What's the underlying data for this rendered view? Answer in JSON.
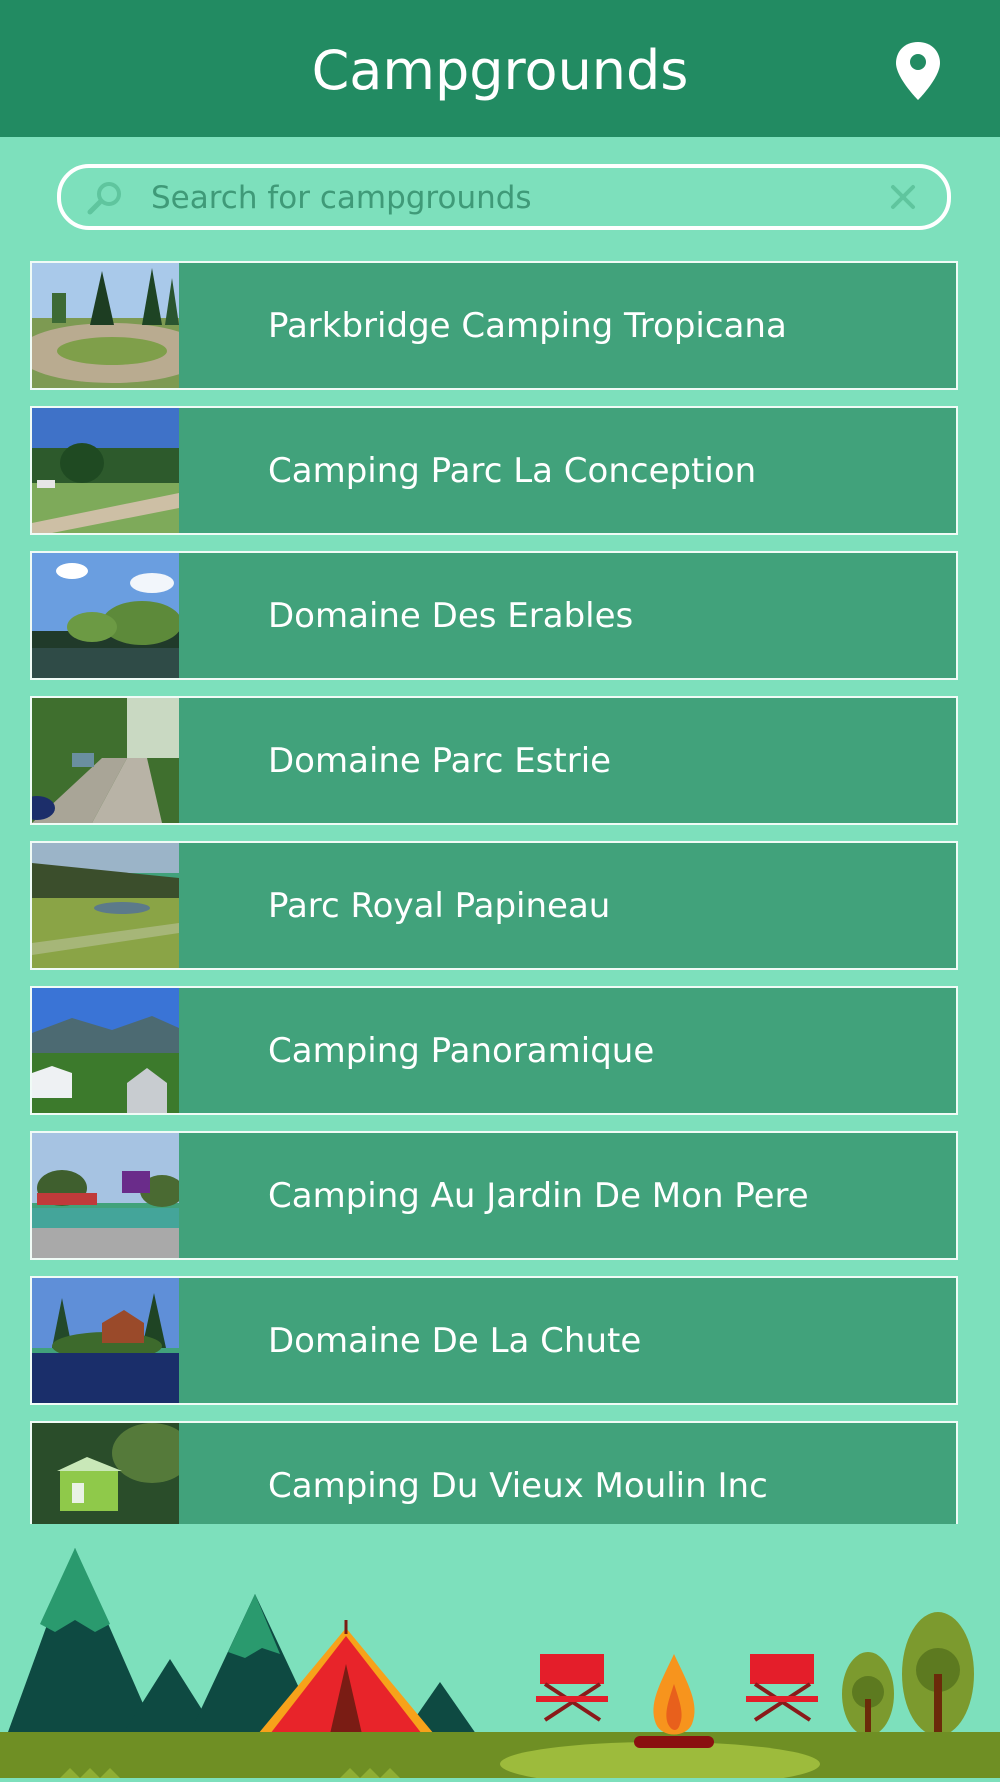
{
  "header": {
    "title": "Campgrounds",
    "map_icon": "map-pin-icon"
  },
  "search": {
    "placeholder": "Search for campgrounds",
    "value": "",
    "search_icon": "search-icon",
    "clear_icon": "close-icon"
  },
  "campgrounds": [
    {
      "name": "Parkbridge Camping Tropicana"
    },
    {
      "name": "Camping Parc La Conception"
    },
    {
      "name": "Domaine Des Erables"
    },
    {
      "name": "Domaine Parc Estrie"
    },
    {
      "name": "Parc Royal Papineau"
    },
    {
      "name": "Camping Panoramique"
    },
    {
      "name": "Camping Au Jardin De Mon Pere"
    },
    {
      "name": "Domaine De La Chute"
    },
    {
      "name": "Camping Du Vieux Moulin Inc"
    }
  ],
  "colors": {
    "header_bg": "#228b62",
    "page_bg": "#7de0bc",
    "row_bg": "#41a27b",
    "text": "#ffffff"
  }
}
